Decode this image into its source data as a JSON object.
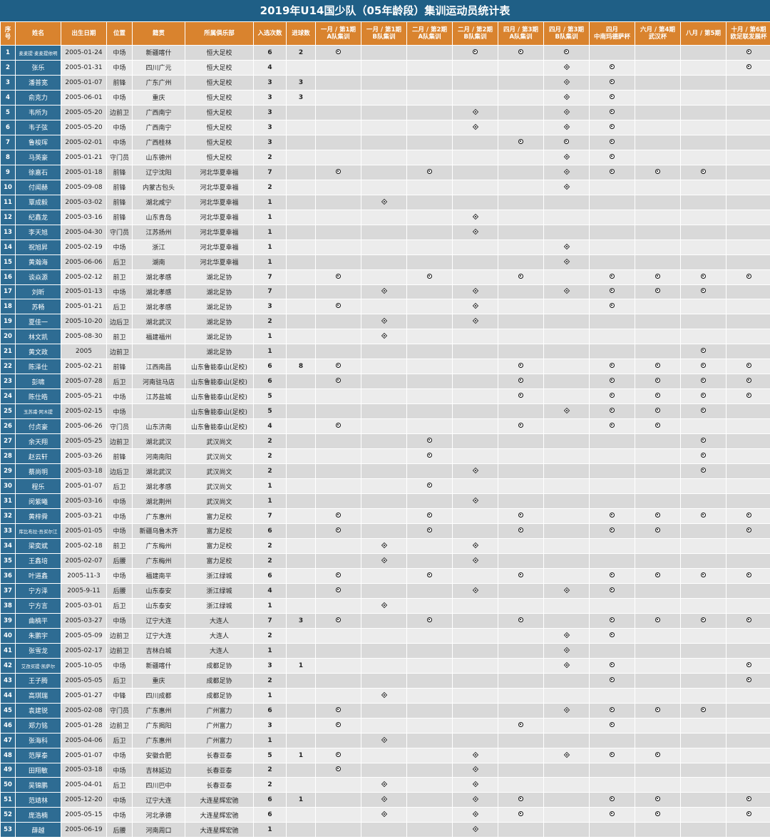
{
  "title": "2019年U14国少队（05年龄段）集训运动员统计表",
  "headers": [
    "序\n号",
    "姓名",
    "出生日期",
    "位置",
    "籍贯",
    "所属俱乐部",
    "入选次数",
    "进球数",
    "一月 / 第1期\nA队集训",
    "一月 / 第1期\nB队集训",
    "二月 / 第2期\nA队集训",
    "二月 / 第2期\nB队集训",
    "四月 / 第3期\nA队集训",
    "四月 / 第3期\nB队集训",
    "四月\n中南玛德萨杯",
    "六月 / 第4期\n武汉杯",
    "八月 / 第5期",
    "十月 / 第6期\n欧足联发展杯"
  ],
  "legend": {
    "A": "circle-dot-icon",
    "B": "diamond-dot-icon"
  },
  "rows": [
    {
      "no": "1",
      "name": "麦麦提·麦麦提依明",
      "birth": "2005-01-24",
      "pos": "中场",
      "origin": "新疆喀什",
      "club": "恒大足校",
      "caps": "6",
      "goals": "2",
      "marks": "A--B--A-A-A----A"
    },
    {
      "no": "2",
      "name": "张乐",
      "birth": "2005-01-31",
      "pos": "中场",
      "origin": "四川广元",
      "club": "恒大足校",
      "caps": "4",
      "goals": "",
      "marks": "----------BAA--A"
    },
    {
      "no": "3",
      "name": "潘普宽",
      "birth": "2005-01-07",
      "pos": "前锋",
      "origin": "广东广州",
      "club": "恒大足校",
      "caps": "3",
      "goals": "3",
      "marks": "----------BAA---"
    },
    {
      "no": "4",
      "name": "俞克力",
      "birth": "2005-06-01",
      "pos": "中场",
      "origin": "重庆",
      "club": "恒大足校",
      "caps": "3",
      "goals": "3",
      "marks": "----------BAA---"
    },
    {
      "no": "5",
      "name": "韦所为",
      "birth": "2005-05-20",
      "pos": "边前卫",
      "origin": "广西南宁",
      "club": "恒大足校",
      "caps": "3",
      "goals": "",
      "marks": "------B---B-A---"
    },
    {
      "no": "6",
      "name": "韦子弦",
      "birth": "2005-05-20",
      "pos": "中场",
      "origin": "广西南宁",
      "club": "恒大足校",
      "caps": "3",
      "goals": "",
      "marks": "------B---B-A---"
    },
    {
      "no": "7",
      "name": "鲁梭珲",
      "birth": "2005-02-01",
      "pos": "中场",
      "origin": "广西桂林",
      "club": "恒大足校",
      "caps": "3",
      "goals": "",
      "marks": "--------A-A-A---"
    },
    {
      "no": "8",
      "name": "马英豪",
      "birth": "2005-01-21",
      "pos": "守门员",
      "origin": "山东德州",
      "club": "恒大足校",
      "caps": "2",
      "goals": "",
      "marks": "----------B-A---"
    },
    {
      "no": "9",
      "name": "徐嘉石",
      "birth": "2005-01-18",
      "pos": "前锋",
      "origin": "辽宁沈阳",
      "club": "河北华夏幸福",
      "caps": "7",
      "goals": "",
      "marks": "A---A-----BAAAA-"
    },
    {
      "no": "10",
      "name": "付闻赫",
      "birth": "2005-09-08",
      "pos": "前锋",
      "origin": "内蒙古包头",
      "club": "河北华夏幸福",
      "caps": "2",
      "goals": "",
      "marks": "----------BA----"
    },
    {
      "no": "11",
      "name": "覃成毅",
      "birth": "2005-03-02",
      "pos": "前锋",
      "origin": "湖北咸宁",
      "club": "河北华夏幸福",
      "caps": "1",
      "goals": "",
      "marks": "--B-------------"
    },
    {
      "no": "12",
      "name": "纪鑫龙",
      "birth": "2005-03-16",
      "pos": "前锋",
      "origin": "山东青岛",
      "club": "河北华夏幸福",
      "caps": "1",
      "goals": "",
      "marks": "------B---------"
    },
    {
      "no": "13",
      "name": "李天旭",
      "birth": "2005-04-30",
      "pos": "守门员",
      "origin": "江苏扬州",
      "club": "河北华夏幸福",
      "caps": "1",
      "goals": "",
      "marks": "------B---------"
    },
    {
      "no": "14",
      "name": "祝旭昇",
      "birth": "2005-02-19",
      "pos": "中场",
      "origin": "浙江",
      "club": "河北华夏幸福",
      "caps": "1",
      "goals": "",
      "marks": "----------B-----"
    },
    {
      "no": "15",
      "name": "黄瀚海",
      "birth": "2005-06-06",
      "pos": "后卫",
      "origin": "湖南",
      "club": "河北华夏幸福",
      "caps": "1",
      "goals": "",
      "marks": "----------B-----"
    },
    {
      "no": "16",
      "name": "谈焱源",
      "birth": "2005-02-12",
      "pos": "前卫",
      "origin": "湖北孝感",
      "club": "湖北足协",
      "caps": "7",
      "goals": "",
      "marks": "A---A---A---AAAA"
    },
    {
      "no": "17",
      "name": "刘昕",
      "birth": "2005-01-13",
      "pos": "中场",
      "origin": "湖北孝感",
      "club": "湖北足协",
      "caps": "7",
      "goals": "",
      "marks": "--B---B---BAAAA-"
    },
    {
      "no": "18",
      "name": "苏畅",
      "birth": "2005-01-21",
      "pos": "后卫",
      "origin": "湖北孝感",
      "club": "湖北足协",
      "caps": "3",
      "goals": "",
      "marks": "A-----B-----A---"
    },
    {
      "no": "19",
      "name": "夏佳一",
      "birth": "2005-10-20",
      "pos": "边后卫",
      "origin": "湖北武汉",
      "club": "湖北足协",
      "caps": "2",
      "goals": "",
      "marks": "--B---B---------"
    },
    {
      "no": "20",
      "name": "林文凯",
      "birth": "2005-08-30",
      "pos": "前卫",
      "origin": "福建福州",
      "club": "湖北足协",
      "caps": "1",
      "goals": "",
      "marks": "--B-------------"
    },
    {
      "no": "21",
      "name": "黄文政",
      "birth": "2005",
      "pos": "边前卫",
      "origin": "",
      "club": "湖北足协",
      "caps": "1",
      "goals": "",
      "marks": "--------------A-"
    },
    {
      "no": "22",
      "name": "陈泽仕",
      "birth": "2005-02-21",
      "pos": "前锋",
      "origin": "江西南昌",
      "club": "山东鲁能泰山(足校)",
      "caps": "6",
      "goals": "8",
      "marks": "A-------A---AAAA"
    },
    {
      "no": "23",
      "name": "彭啸",
      "birth": "2005-07-28",
      "pos": "后卫",
      "origin": "河南驻马店",
      "club": "山东鲁能泰山(足校)",
      "caps": "6",
      "goals": "",
      "marks": "A-------A---AAAA"
    },
    {
      "no": "24",
      "name": "陈仕皓",
      "birth": "2005-05-21",
      "pos": "中场",
      "origin": "江苏盐城",
      "club": "山东鲁能泰山(足校)",
      "caps": "5",
      "goals": "",
      "marks": "--------A---AAAA"
    },
    {
      "no": "25",
      "name": "玉苏甫·阿木提",
      "birth": "2005-02-15",
      "pos": "中场",
      "origin": "",
      "club": "山东鲁能泰山(足校)",
      "caps": "5",
      "goals": "",
      "marks": "----------BAAAA-"
    },
    {
      "no": "26",
      "name": "付贞豪",
      "birth": "2005-06-26",
      "pos": "守门员",
      "origin": "山东济南",
      "club": "山东鲁能泰山(足校)",
      "caps": "4",
      "goals": "",
      "marks": "A-------A---AA--"
    },
    {
      "no": "27",
      "name": "余天翔",
      "birth": "2005-05-25",
      "pos": "边前卫",
      "origin": "湖北武汉",
      "club": "武汉尚文",
      "caps": "2",
      "goals": "",
      "marks": "----A---------A-"
    },
    {
      "no": "28",
      "name": "赵云轩",
      "birth": "2005-03-26",
      "pos": "前锋",
      "origin": "河南南阳",
      "club": "武汉尚文",
      "caps": "2",
      "goals": "",
      "marks": "----A---------A-"
    },
    {
      "no": "29",
      "name": "蔡尚明",
      "birth": "2005-03-18",
      "pos": "边后卫",
      "origin": "湖北武汉",
      "club": "武汉尚文",
      "caps": "2",
      "goals": "",
      "marks": "------B-------A-"
    },
    {
      "no": "30",
      "name": "程乐",
      "birth": "2005-01-07",
      "pos": "后卫",
      "origin": "湖北孝感",
      "club": "武汉尚文",
      "caps": "1",
      "goals": "",
      "marks": "----A-----------"
    },
    {
      "no": "31",
      "name": "闵紫曦",
      "birth": "2005-03-16",
      "pos": "中场",
      "origin": "湖北荆州",
      "club": "武汉尚文",
      "caps": "1",
      "goals": "",
      "marks": "------B---------"
    },
    {
      "no": "32",
      "name": "黄梓舜",
      "birth": "2005-03-21",
      "pos": "中场",
      "origin": "广东惠州",
      "club": "富力足校",
      "caps": "7",
      "goals": "",
      "marks": "A---A---A---AAAA"
    },
    {
      "no": "33",
      "name": "库比布拉·吾买尔江",
      "birth": "2005-01-05",
      "pos": "中场",
      "origin": "新疆乌鲁木齐",
      "club": "富力足校",
      "caps": "6",
      "goals": "",
      "marks": "A---A---A---AA-A"
    },
    {
      "no": "34",
      "name": "梁奕斌",
      "birth": "2005-02-18",
      "pos": "前卫",
      "origin": "广东梅州",
      "club": "富力足校",
      "caps": "2",
      "goals": "",
      "marks": "--B---B---------"
    },
    {
      "no": "35",
      "name": "王鑫培",
      "birth": "2005-02-07",
      "pos": "后腰",
      "origin": "广东梅州",
      "club": "富力足校",
      "caps": "2",
      "goals": "",
      "marks": "--B---B---------"
    },
    {
      "no": "36",
      "name": "叶道鑫",
      "birth": "2005-11-3",
      "pos": "中场",
      "origin": "福建南平",
      "club": "浙江绿城",
      "caps": "6",
      "goals": "",
      "marks": "A---A---A---AAAA"
    },
    {
      "no": "37",
      "name": "宁方泽",
      "birth": "2005-9-11",
      "pos": "后腰",
      "origin": "山东泰安",
      "club": "浙江绿城",
      "caps": "4",
      "goals": "",
      "marks": "A-----B---B-A---"
    },
    {
      "no": "38",
      "name": "宁方言",
      "birth": "2005-03-01",
      "pos": "后卫",
      "origin": "山东泰安",
      "club": "浙江绿城",
      "caps": "1",
      "goals": "",
      "marks": "--B-------------"
    },
    {
      "no": "39",
      "name": "曲楠平",
      "birth": "2005-03-27",
      "pos": "中场",
      "origin": "辽宁大连",
      "club": "大连人",
      "caps": "7",
      "goals": "3",
      "marks": "A---A---A---AAAA"
    },
    {
      "no": "40",
      "name": "朱鹏宇",
      "birth": "2005-05-09",
      "pos": "边前卫",
      "origin": "辽宁大连",
      "club": "大连人",
      "caps": "2",
      "goals": "",
      "marks": "----------B-A---"
    },
    {
      "no": "41",
      "name": "张雪龙",
      "birth": "2005-02-17",
      "pos": "边前卫",
      "origin": "吉林白城",
      "club": "大连人",
      "caps": "1",
      "goals": "",
      "marks": "----------B-----"
    },
    {
      "no": "42",
      "name": "艾孜买提·凯萨尔",
      "birth": "2005-10-05",
      "pos": "中场",
      "origin": "新疆喀什",
      "club": "成都足协",
      "caps": "3",
      "goals": "1",
      "marks": "----------B-A--A"
    },
    {
      "no": "43",
      "name": "王子腾",
      "birth": "2005-05-05",
      "pos": "后卫",
      "origin": "重庆",
      "club": "成都足协",
      "caps": "2",
      "goals": "",
      "marks": "------------A--A"
    },
    {
      "no": "44",
      "name": "高琪瑞",
      "birth": "2005-01-27",
      "pos": "中锋",
      "origin": "四川成都",
      "club": "成都足协",
      "caps": "1",
      "goals": "",
      "marks": "--B-------------"
    },
    {
      "no": "45",
      "name": "袁建锐",
      "birth": "2005-02-08",
      "pos": "守门员",
      "origin": "广东惠州",
      "club": "广州富力",
      "caps": "6",
      "goals": "",
      "marks": "A---------BAAAA-"
    },
    {
      "no": "46",
      "name": "郑力铭",
      "birth": "2005-01-28",
      "pos": "边前卫",
      "origin": "广东揭阳",
      "club": "广州富力",
      "caps": "3",
      "goals": "",
      "marks": "A-------A---A---"
    },
    {
      "no": "47",
      "name": "张海科",
      "birth": "2005-04-06",
      "pos": "后卫",
      "origin": "广东惠州",
      "club": "广州富力",
      "caps": "1",
      "goals": "",
      "marks": "--B-------------"
    },
    {
      "no": "48",
      "name": "范厚泰",
      "birth": "2005-01-07",
      "pos": "中场",
      "origin": "安徽合肥",
      "club": "长春亚泰",
      "caps": "5",
      "goals": "1",
      "marks": "A-----B---B-AA--"
    },
    {
      "no": "49",
      "name": "田翔敏",
      "birth": "2005-03-18",
      "pos": "中场",
      "origin": "吉林延边",
      "club": "长春亚泰",
      "caps": "2",
      "goals": "",
      "marks": "A-----B---------"
    },
    {
      "no": "50",
      "name": "吴锦鹏",
      "birth": "2005-04-01",
      "pos": "后卫",
      "origin": "四川巴中",
      "club": "长春亚泰",
      "caps": "2",
      "goals": "",
      "marks": "--B---B---------"
    },
    {
      "no": "51",
      "name": "范靖林",
      "birth": "2005-12-20",
      "pos": "中场",
      "origin": "辽宁大连",
      "club": "大连星辉宏驰",
      "caps": "6",
      "goals": "1",
      "marks": "--B---B-A---AA-A"
    },
    {
      "no": "52",
      "name": "庞浩楠",
      "birth": "2005-05-15",
      "pos": "中场",
      "origin": "河北承德",
      "club": "大连星辉宏驰",
      "caps": "6",
      "goals": "",
      "marks": "--B---B-A---AA-A"
    },
    {
      "no": "53",
      "name": "薛越",
      "birth": "2005-06-19",
      "pos": "后腰",
      "origin": "河南周口",
      "club": "大连星辉宏驰",
      "caps": "1",
      "goals": "",
      "marks": "------B---------"
    }
  ]
}
